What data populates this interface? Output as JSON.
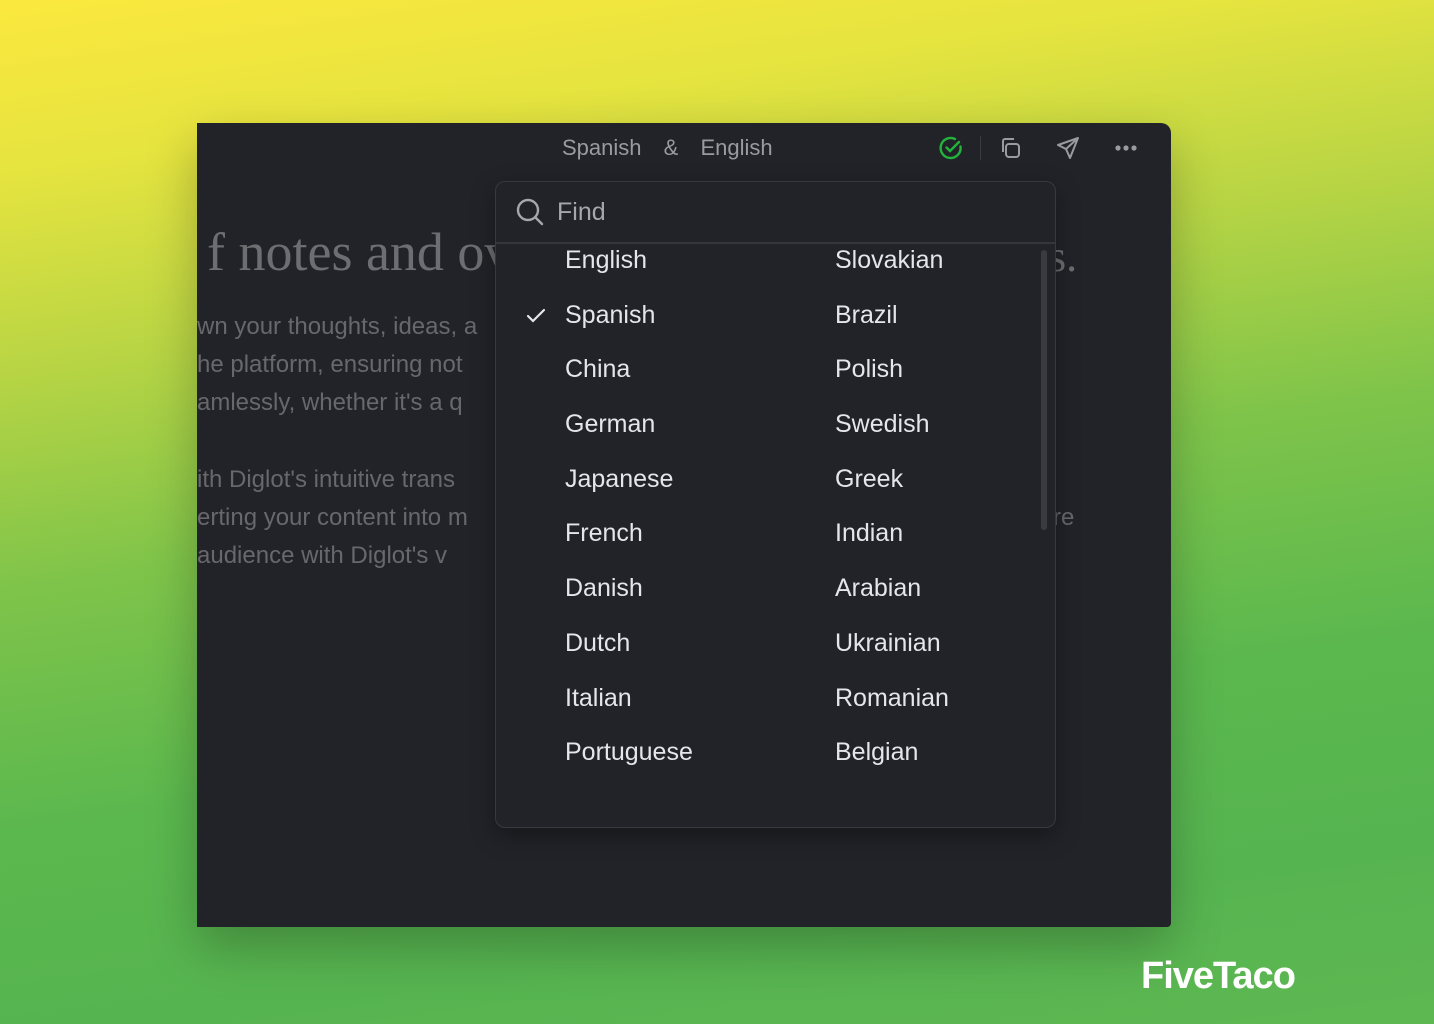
{
  "header": {
    "source_lang": "Spanish",
    "separator": "&",
    "target_lang": "English"
  },
  "toolbar": {
    "icons": [
      "check-circle-icon",
      "copy-icon",
      "send-icon",
      "more-icon"
    ],
    "status_color": "#22b43a"
  },
  "background_doc": {
    "heading_left": "f notes and ov",
    "heading_right": "s.",
    "lines": [
      "wn your thoughts, ideas, a",
      "he platform, ensuring not",
      "amlessly, whether it's a q",
      "ith Diglot's intuitive trans",
      "erting your content into m",
      " audience with Diglot's v"
    ],
    "line_right": "re"
  },
  "dropdown": {
    "search_placeholder": "Find",
    "selected": "Spanish",
    "languages_col1": [
      "English",
      "Spanish",
      "China",
      "German",
      "Japanese",
      "French",
      "Danish",
      "Dutch",
      "Italian",
      "Portuguese"
    ],
    "languages_col2": [
      "Slovakian",
      "Brazil",
      "Polish",
      "Swedish",
      "Greek",
      "Indian",
      "Arabian",
      "Ukrainian",
      "Romanian",
      "Belgian"
    ]
  },
  "brand": "FiveTaco"
}
